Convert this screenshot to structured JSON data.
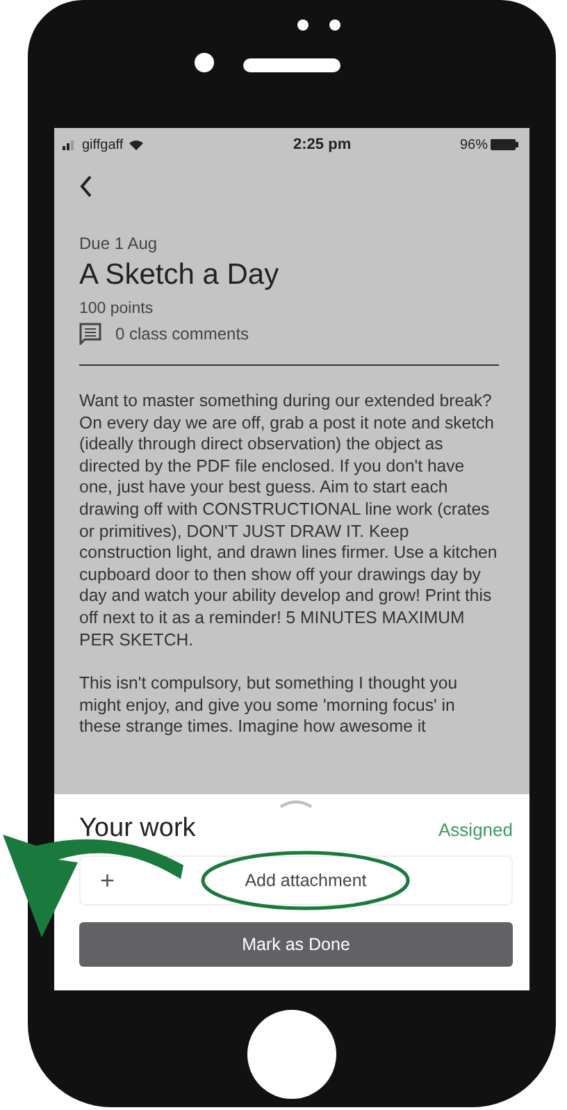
{
  "status_bar": {
    "carrier": "giffgaff",
    "time": "2:25 pm",
    "battery": "96%"
  },
  "assignment": {
    "due": "Due 1 Aug",
    "title": "A Sketch a Day",
    "points": "100 points",
    "comments": "0 class comments"
  },
  "description": [
    "Want to master something during our extended break? On every day we are off, grab a post it note and sketch (ideally through direct observation) the object as directed by the PDF file enclosed.  If you don't have one, just have your best guess.  Aim to start each drawing off with CONSTRUCTIONAL line work (crates or primitives), DON'T JUST DRAW IT.   Keep construction light, and drawn lines firmer. Use a kitchen cupboard door to then show off your drawings day by day and watch your ability develop and grow!  Print this off next to it as a reminder! 5 MINUTES MAXIMUM PER SKETCH.",
    "This isn't compulsory, but something I thought you might enjoy, and give you some 'morning focus' in these strange times. Imagine how awesome it"
  ],
  "your_work": {
    "title": "Your work",
    "status": "Assigned",
    "add_icon": "+",
    "add_label": "Add attachment",
    "button": "Mark as Done"
  }
}
